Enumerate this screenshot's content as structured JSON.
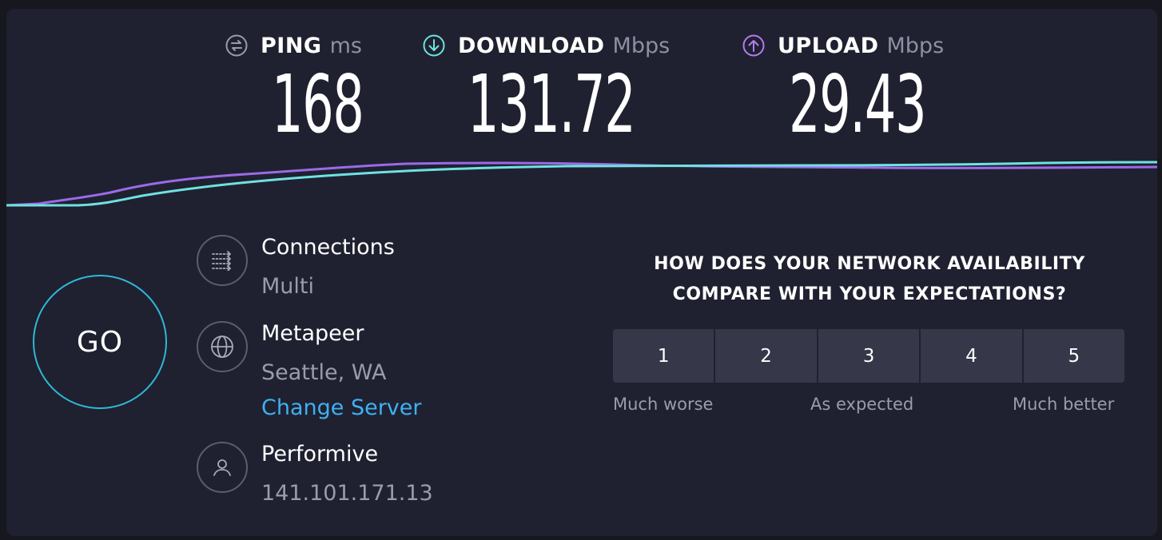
{
  "metrics": {
    "ping": {
      "label": "PING",
      "unit": "ms",
      "value": "168",
      "icon": "ping-icon",
      "color": "#9a9bab"
    },
    "download": {
      "label": "DOWNLOAD",
      "unit": "Mbps",
      "value": "131.72",
      "icon": "download-arrow-icon",
      "color": "#6fe2e0"
    },
    "upload": {
      "label": "UPLOAD",
      "unit": "Mbps",
      "value": "29.43",
      "icon": "upload-arrow-icon",
      "color": "#b57bf2"
    }
  },
  "graph": {
    "download_color": "#6fe2e0",
    "upload_color": "#9b6ae8"
  },
  "go_button": {
    "label": "GO",
    "ring_color": "#2fb8d8"
  },
  "info": {
    "connections": {
      "icon": "connections-icon",
      "title": "Connections",
      "value": "Multi"
    },
    "isp": {
      "icon": "globe-icon",
      "title": "Metapeer",
      "location": "Seattle, WA",
      "change_server": "Change Server"
    },
    "host": {
      "icon": "user-icon",
      "title": "Performive",
      "ip": "141.101.171.13"
    }
  },
  "survey": {
    "question_line1": "HOW DOES YOUR NETWORK AVAILABILITY",
    "question_line2": "COMPARE WITH YOUR EXPECTATIONS?",
    "options": [
      "1",
      "2",
      "3",
      "4",
      "5"
    ],
    "label_low": "Much worse",
    "label_mid": "As expected",
    "label_high": "Much better"
  },
  "colors": {
    "background": "#1f2130",
    "accent_link": "#3fb0f2",
    "button_bg": "#363849"
  }
}
